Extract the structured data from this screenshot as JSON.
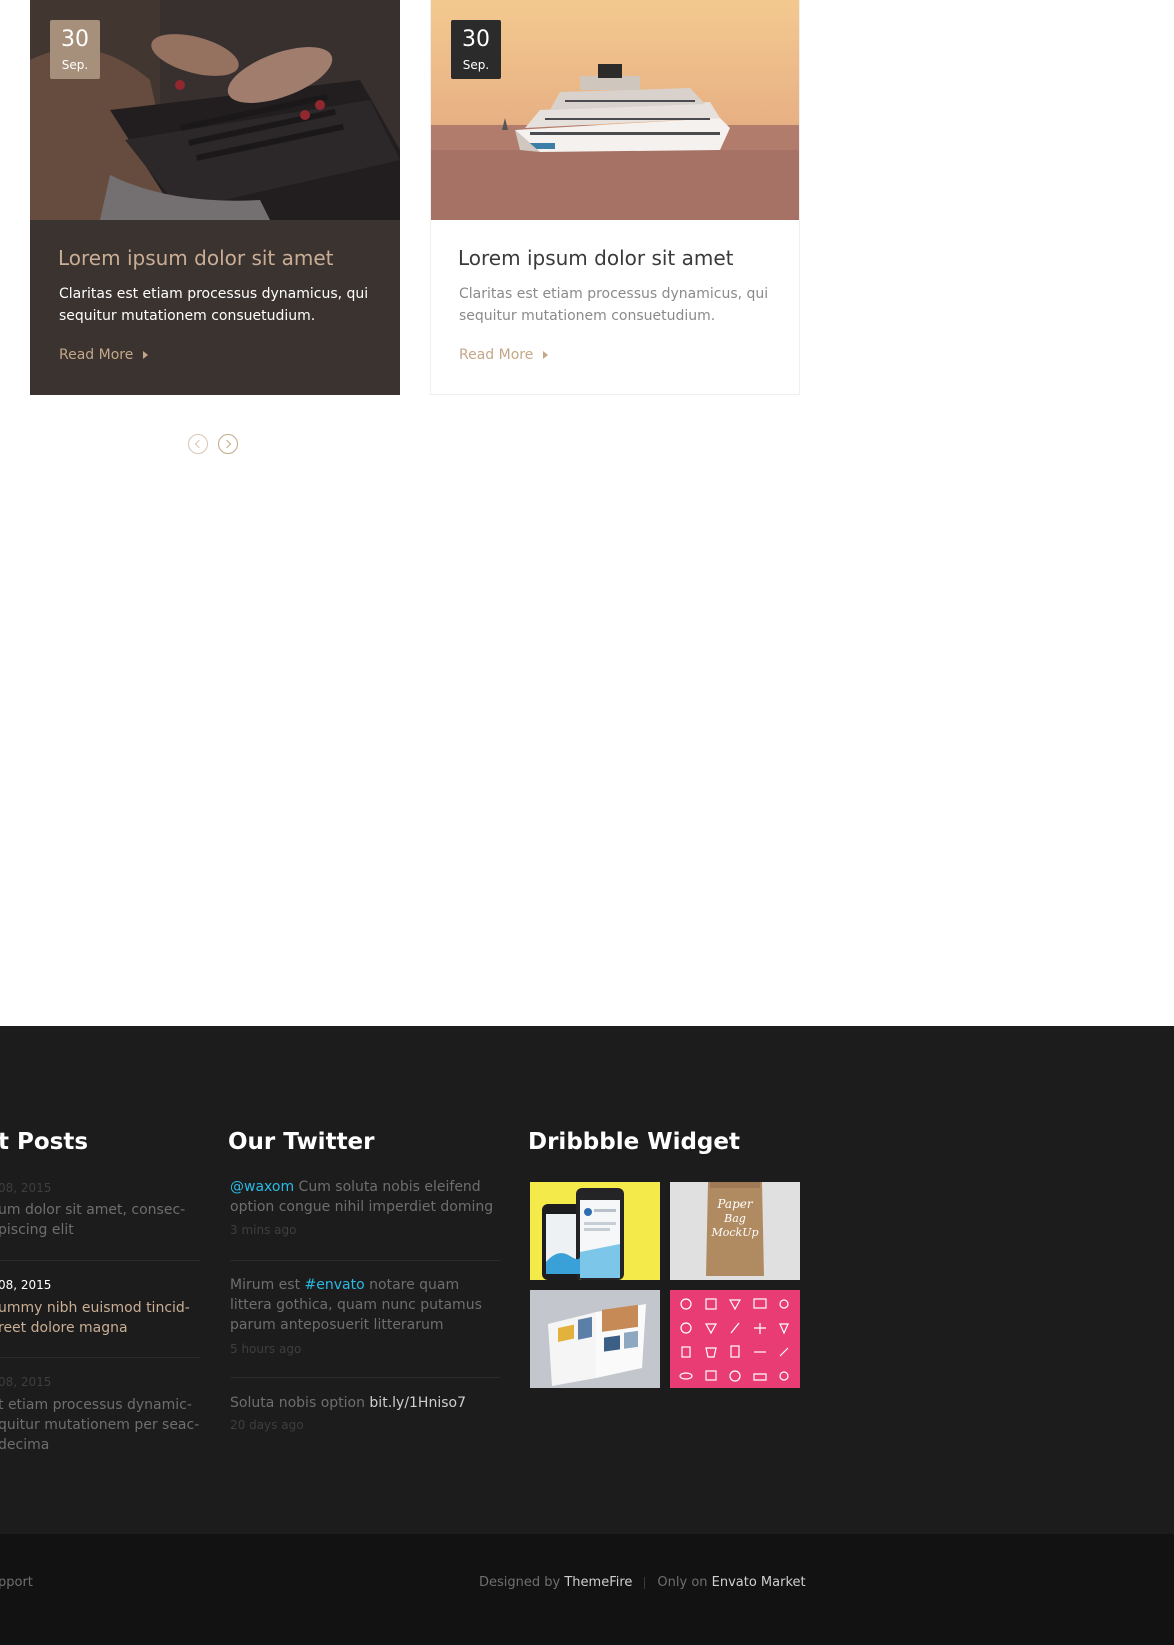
{
  "blog": {
    "posts": [
      {
        "day": "30",
        "month": "Sep.",
        "title": "Lorem ipsum dolor sit amet",
        "excerpt": "Claritas est etiam processus dynamicus, qui sequitur mutationem consuetudium.",
        "read_more": "Read More",
        "image": "laptop-typing-photo"
      },
      {
        "day": "30",
        "month": "Sep.",
        "title": "Lorem ipsum dolor sit amet",
        "excerpt": "Claritas est etiam processus dynamicus, qui sequitur mutationem consuetudium.",
        "read_more": "Read More",
        "image": "cruise-ship-photo"
      }
    ],
    "pager": {
      "prev_icon": "chevron-left-icon",
      "next_icon": "chevron-right-icon"
    }
  },
  "footer": {
    "recent_posts": {
      "title": "t Posts",
      "items": [
        {
          "date": "08, 2015",
          "line1": "um dolor sit amet, consec-",
          "line2": "piscing elit"
        },
        {
          "date": "08, 2015",
          "line1": "ummy nibh euismod tincid-",
          "line2": "reet dolore magna"
        },
        {
          "date": "08, 2015",
          "line1": "t etiam processus dynamic-",
          "line2": "quitur mutationem per seac-",
          "line3": " decima"
        }
      ]
    },
    "twitter": {
      "title": "Our Twitter",
      "tweets": [
        {
          "handle": "@waxom",
          "text": " Cum soluta nobis eleifend option congue nihil imperdiet doming",
          "time": "3 mins ago"
        },
        {
          "before": "Mirum est ",
          "hashtag": "#envato",
          "after": " notare quam littera gothica, quam nunc putamus parum anteposuerit litterarum",
          "time": "5 hours ago"
        },
        {
          "before": "Soluta nobis option ",
          "link": "bit.ly/1Hniso7",
          "time": "20 days ago"
        }
      ]
    },
    "dribbble": {
      "title": "Dribbble Widget",
      "shots": [
        "phone-app-shot",
        "paper-bag-mockup-shot",
        "magazine-spread-shot",
        "pink-icon-set-shot"
      ]
    },
    "bottom": {
      "left_text": "pport",
      "designed_by": "Designed by ",
      "designer": "ThemeFire",
      "only_on": "Only on ",
      "market": "Envato Market"
    }
  }
}
